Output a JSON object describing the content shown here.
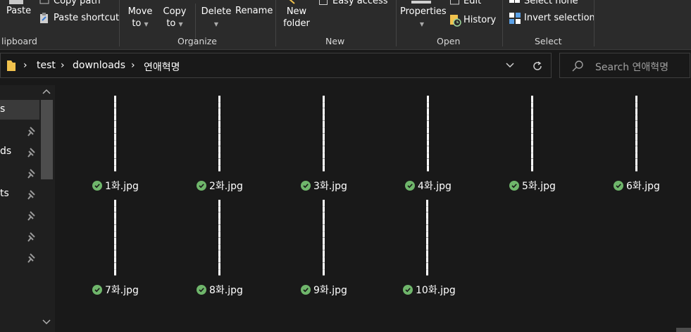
{
  "ribbon": {
    "clipboard": {
      "label": "lipboard",
      "paste": "Paste",
      "copy_path": "Copy path",
      "paste_shortcut": "Paste shortcut"
    },
    "organize": {
      "label": "Organize",
      "move_to_1": "Move",
      "move_to_2": "to",
      "copy_to_1": "Copy",
      "copy_to_2": "to",
      "delete": "Delete",
      "rename": "Rename"
    },
    "new": {
      "label": "New",
      "new_folder_1": "New",
      "new_folder_2": "folder",
      "easy_access": "Easy access"
    },
    "open": {
      "label": "Open",
      "properties": "Properties",
      "edit": "Edit",
      "history": "History"
    },
    "select": {
      "label": "Select",
      "select_none": "Select none",
      "invert_selection": "Invert selection"
    }
  },
  "address": {
    "crumbs": [
      "test",
      "downloads",
      "연애혁명"
    ]
  },
  "search": {
    "placeholder": "Search 연애혁명"
  },
  "nav": {
    "items": [
      "s",
      "",
      "ds",
      "",
      "ts",
      "",
      "",
      ""
    ]
  },
  "files": [
    {
      "name": "1화.jpg",
      "status": "synced"
    },
    {
      "name": "2화.jpg",
      "status": "synced"
    },
    {
      "name": "3화.jpg",
      "status": "synced"
    },
    {
      "name": "4화.jpg",
      "status": "synced"
    },
    {
      "name": "5화.jpg",
      "status": "synced"
    },
    {
      "name": "6화.jpg",
      "status": "synced"
    },
    {
      "name": "7화.jpg",
      "status": "synced"
    },
    {
      "name": "8화.jpg",
      "status": "synced"
    },
    {
      "name": "9화.jpg",
      "status": "synced"
    },
    {
      "name": "10화.jpg",
      "status": "synced"
    }
  ],
  "colors": {
    "background": "#191919",
    "ribbon": "#2b2b2b",
    "sync_check": "#6fb66b",
    "folder": "#f1c24d"
  }
}
